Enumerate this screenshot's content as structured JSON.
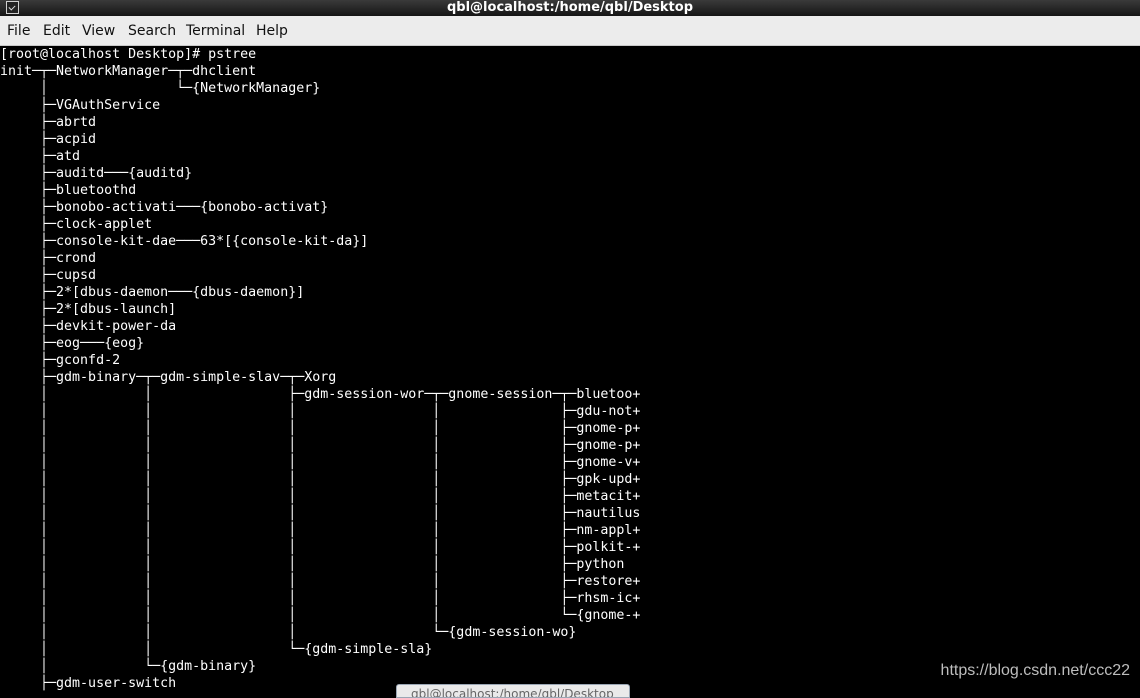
{
  "window": {
    "title": "qbl@localhost:/home/qbl/Desktop"
  },
  "menu": [
    "File",
    "Edit",
    "View",
    "Search",
    "Terminal",
    "Help"
  ],
  "terminal": {
    "lines": [
      "[root@localhost Desktop]# pstree",
      "init─┬─NetworkManager─┬─dhclient",
      "     │                └─{NetworkManager}",
      "     ├─VGAuthService",
      "     ├─abrtd",
      "     ├─acpid",
      "     ├─atd",
      "     ├─auditd───{auditd}",
      "     ├─bluetoothd",
      "     ├─bonobo-activati───{bonobo-activat}",
      "     ├─clock-applet",
      "     ├─console-kit-dae───63*[{console-kit-da}]",
      "     ├─crond",
      "     ├─cupsd",
      "     ├─2*[dbus-daemon───{dbus-daemon}]",
      "     ├─2*[dbus-launch]",
      "     ├─devkit-power-da",
      "     ├─eog───{eog}",
      "     ├─gconfd-2",
      "     ├─gdm-binary─┬─gdm-simple-slav─┬─Xorg",
      "     │            │                 ├─gdm-session-wor─┬─gnome-session─┬─bluetoo+",
      "     │            │                 │                 │               ├─gdu-not+",
      "     │            │                 │                 │               ├─gnome-p+",
      "     │            │                 │                 │               ├─gnome-p+",
      "     │            │                 │                 │               ├─gnome-v+",
      "     │            │                 │                 │               ├─gpk-upd+",
      "     │            │                 │                 │               ├─metacit+",
      "     │            │                 │                 │               ├─nautilus",
      "     │            │                 │                 │               ├─nm-appl+",
      "     │            │                 │                 │               ├─polkit-+",
      "     │            │                 │                 │               ├─python",
      "     │            │                 │                 │               ├─restore+",
      "     │            │                 │                 │               ├─rhsm-ic+",
      "     │            │                 │                 │               └─{gnome-+",
      "     │            │                 │                 └─{gdm-session-wo}",
      "     │            │                 └─{gdm-simple-sla}",
      "     │            └─{gdm-binary}",
      "     ├─gdm-user-switch"
    ]
  },
  "watermark": "https://blog.csdn.net/ccc22",
  "taskbar": {
    "item": "qbl@localhost:/home/qbl/Desktop"
  }
}
